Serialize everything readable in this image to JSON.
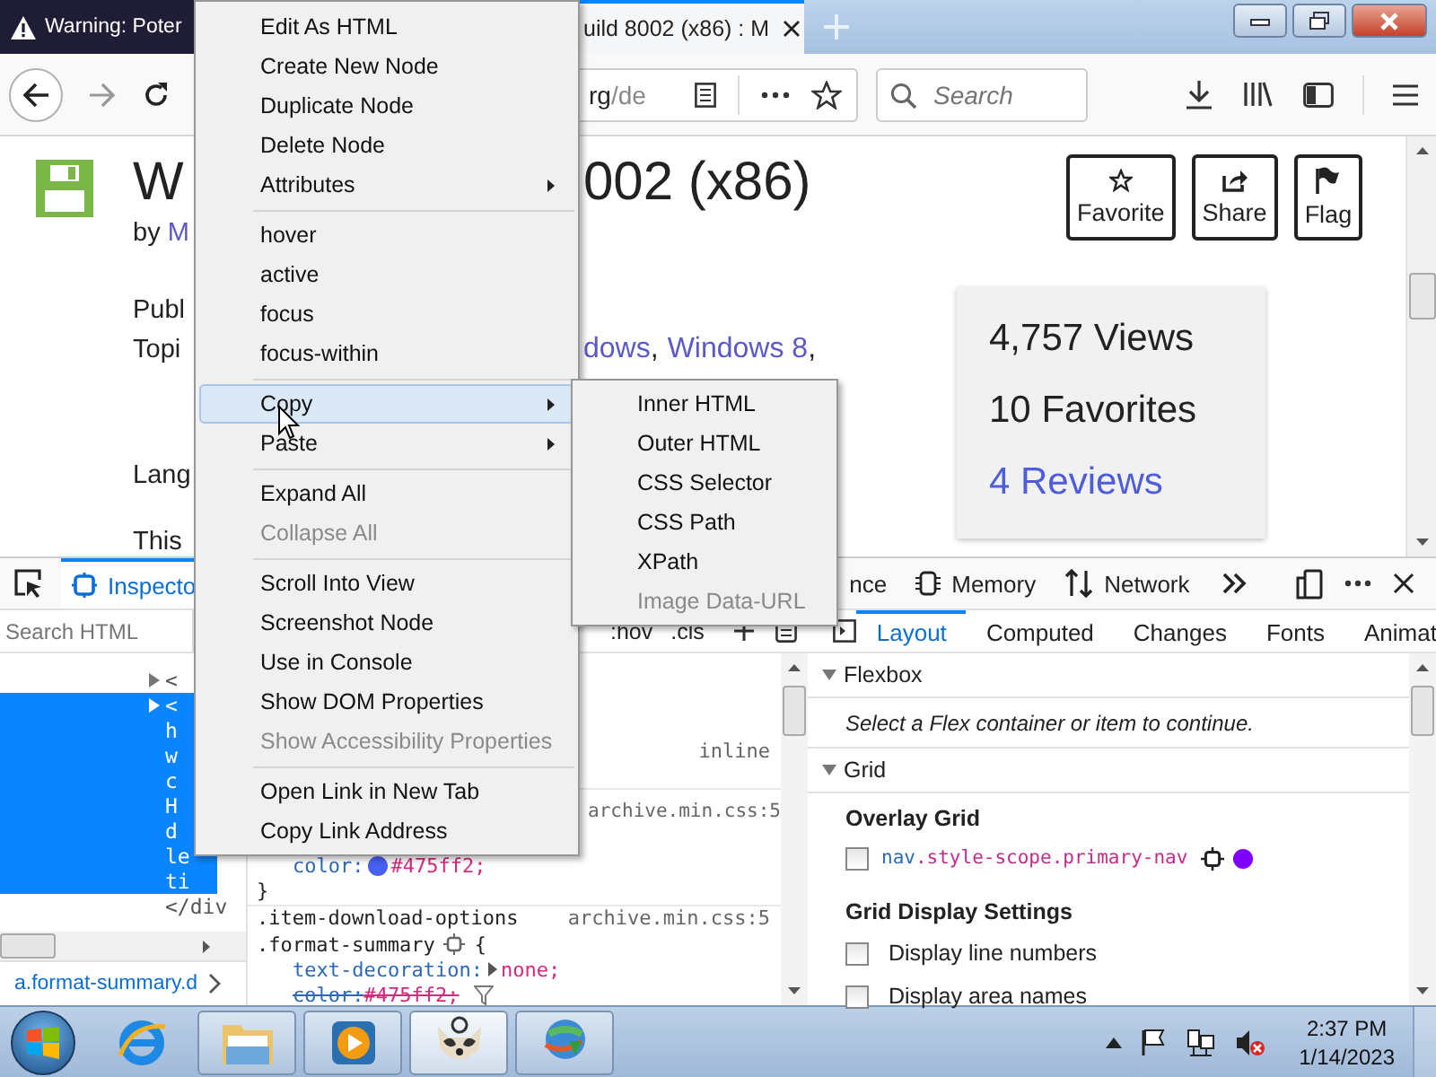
{
  "browser": {
    "tabs": [
      {
        "title": "Warning: Poter",
        "selected": false
      },
      {
        "title": "uild 8002 (x86) : M",
        "selected": true
      }
    ],
    "url": {
      "host": "rg",
      "path": "/de"
    },
    "search": {
      "placeholder": "Search"
    }
  },
  "page": {
    "title_left": "W",
    "title_right": "002 (x86)",
    "byline": {
      "prefix": "by",
      "author": "M"
    },
    "lines": [
      "Publ",
      "Topi",
      "Lang",
      "This"
    ],
    "topics": [
      {
        "text": "dows",
        "link": true,
        "suffix": ","
      },
      {
        "text": "Windows 8",
        "link": true,
        "suffix": ","
      }
    ],
    "actions": [
      "Favorite",
      "Share",
      "Flag"
    ],
    "stats": [
      {
        "text": "4,757 Views",
        "link": false
      },
      {
        "text": "10 Favorites",
        "link": false
      },
      {
        "text": "4 Reviews",
        "link": true
      }
    ]
  },
  "context_menu": {
    "groups": [
      {
        "items": [
          {
            "label": "Edit As HTML",
            "submenu": false,
            "disabled": false,
            "selected": false
          },
          {
            "label": "Create New Node",
            "submenu": false,
            "disabled": false,
            "selected": false
          },
          {
            "label": "Duplicate Node",
            "submenu": false,
            "disabled": false,
            "selected": false
          },
          {
            "label": "Delete Node",
            "submenu": false,
            "disabled": false,
            "selected": false
          },
          {
            "label": "Attributes",
            "submenu": true,
            "disabled": false,
            "selected": false
          }
        ]
      },
      {
        "items": [
          {
            "label": "hover",
            "submenu": false,
            "disabled": false,
            "selected": false
          },
          {
            "label": "active",
            "submenu": false,
            "disabled": false,
            "selected": false
          },
          {
            "label": "focus",
            "submenu": false,
            "disabled": false,
            "selected": false
          },
          {
            "label": "focus-within",
            "submenu": false,
            "disabled": false,
            "selected": false
          }
        ]
      },
      {
        "items": [
          {
            "label": "Copy",
            "submenu": true,
            "disabled": false,
            "selected": true
          },
          {
            "label": "Paste",
            "submenu": true,
            "disabled": false,
            "selected": false
          }
        ]
      },
      {
        "items": [
          {
            "label": "Expand All",
            "submenu": false,
            "disabled": false,
            "selected": false
          },
          {
            "label": "Collapse All",
            "submenu": false,
            "disabled": true,
            "selected": false
          }
        ]
      },
      {
        "items": [
          {
            "label": "Scroll Into View",
            "submenu": false,
            "disabled": false,
            "selected": false
          },
          {
            "label": "Screenshot Node",
            "submenu": false,
            "disabled": false,
            "selected": false
          },
          {
            "label": "Use in Console",
            "submenu": false,
            "disabled": false,
            "selected": false
          },
          {
            "label": "Show DOM Properties",
            "submenu": false,
            "disabled": false,
            "selected": false
          },
          {
            "label": "Show Accessibility Properties",
            "submenu": false,
            "disabled": true,
            "selected": false
          }
        ]
      },
      {
        "items": [
          {
            "label": "Open Link in New Tab",
            "submenu": false,
            "disabled": false,
            "selected": false
          },
          {
            "label": "Copy Link Address",
            "submenu": false,
            "disabled": false,
            "selected": false
          }
        ]
      }
    ]
  },
  "copy_submenu": {
    "items": [
      {
        "label": "Inner HTML",
        "disabled": false
      },
      {
        "label": "Outer HTML",
        "disabled": false
      },
      {
        "label": "CSS Selector",
        "disabled": false
      },
      {
        "label": "CSS Path",
        "disabled": false
      },
      {
        "label": "XPath",
        "disabled": false
      },
      {
        "label": "Image Data-URL",
        "disabled": true
      }
    ]
  },
  "devtools": {
    "tools": [
      {
        "label": "Inspecto",
        "selected": true
      },
      {
        "label": "nce",
        "selected": false
      },
      {
        "label": "Memory",
        "selected": false
      },
      {
        "label": "Network",
        "selected": false
      }
    ],
    "search": {
      "placeholder": "Search HTML"
    },
    "rule_buttons": [
      ":hov",
      ".cls"
    ],
    "sidebar_tabs": [
      {
        "label": "Layout",
        "selected": true
      },
      {
        "label": "Computed",
        "selected": false
      },
      {
        "label": "Changes",
        "selected": false
      },
      {
        "label": "Fonts",
        "selected": false
      },
      {
        "label": "Animat",
        "selected": false
      }
    ],
    "markup": [
      {
        "text": "<",
        "selected": false,
        "expander": true
      },
      {
        "text": "<",
        "selected": true,
        "expander": true
      },
      {
        "text": "h",
        "selected": true,
        "expander": false
      },
      {
        "text": "w",
        "selected": true,
        "expander": false
      },
      {
        "text": "c",
        "selected": true,
        "expander": false
      },
      {
        "text": "H",
        "selected": true,
        "expander": false
      },
      {
        "text": "d",
        "selected": true,
        "expander": false
      },
      {
        "text": "le",
        "selected": true,
        "expander": false
      },
      {
        "text": "ti",
        "selected": true,
        "expander": false
      },
      {
        "text": "</div",
        "selected": false,
        "expander": false
      }
    ],
    "breadcrumb": "a.format-summary.d",
    "rules": {
      "inline": "inline",
      "source": "archive.min.css:5",
      "color_decl": {
        "property": "color:",
        "value": "#475ff2;",
        "color": "#475ff2"
      },
      "close": "}",
      "second": {
        "source": "archive.min.css:5",
        "selector_lines": [
          ".item-download-options",
          ".format-summary"
        ],
        "open": "{",
        "declarations": [
          {
            "property": "text-decoration:",
            "value": "none;",
            "expander": true,
            "struck": false
          },
          {
            "property": "color:",
            "value": "#475ff2;",
            "expander": false,
            "struck": true
          }
        ]
      }
    },
    "layout": {
      "flexbox": {
        "title": "Flexbox",
        "expanded": true,
        "hint": "Select a Flex container or item to continue."
      },
      "grid": {
        "title": "Grid",
        "expanded": true,
        "overlay_heading": "Overlay Grid",
        "grids": [
          {
            "tag": "nav",
            "classes": ".style-scope.primary-nav",
            "checked": false,
            "color": "#8000ff"
          }
        ],
        "settings_heading": "Grid Display Settings",
        "settings": [
          {
            "label": "Display line numbers",
            "checked": false
          },
          {
            "label": "Display area names",
            "checked": false
          }
        ]
      }
    }
  },
  "taskbar": {
    "apps": [
      {
        "running": false,
        "selected": false
      },
      {
        "running": true,
        "selected": false
      },
      {
        "running": true,
        "selected": false
      },
      {
        "running": true,
        "selected": true
      },
      {
        "running": true,
        "selected": false
      }
    ],
    "clock": {
      "time": "2:37 PM",
      "date": "1/14/2023"
    }
  }
}
